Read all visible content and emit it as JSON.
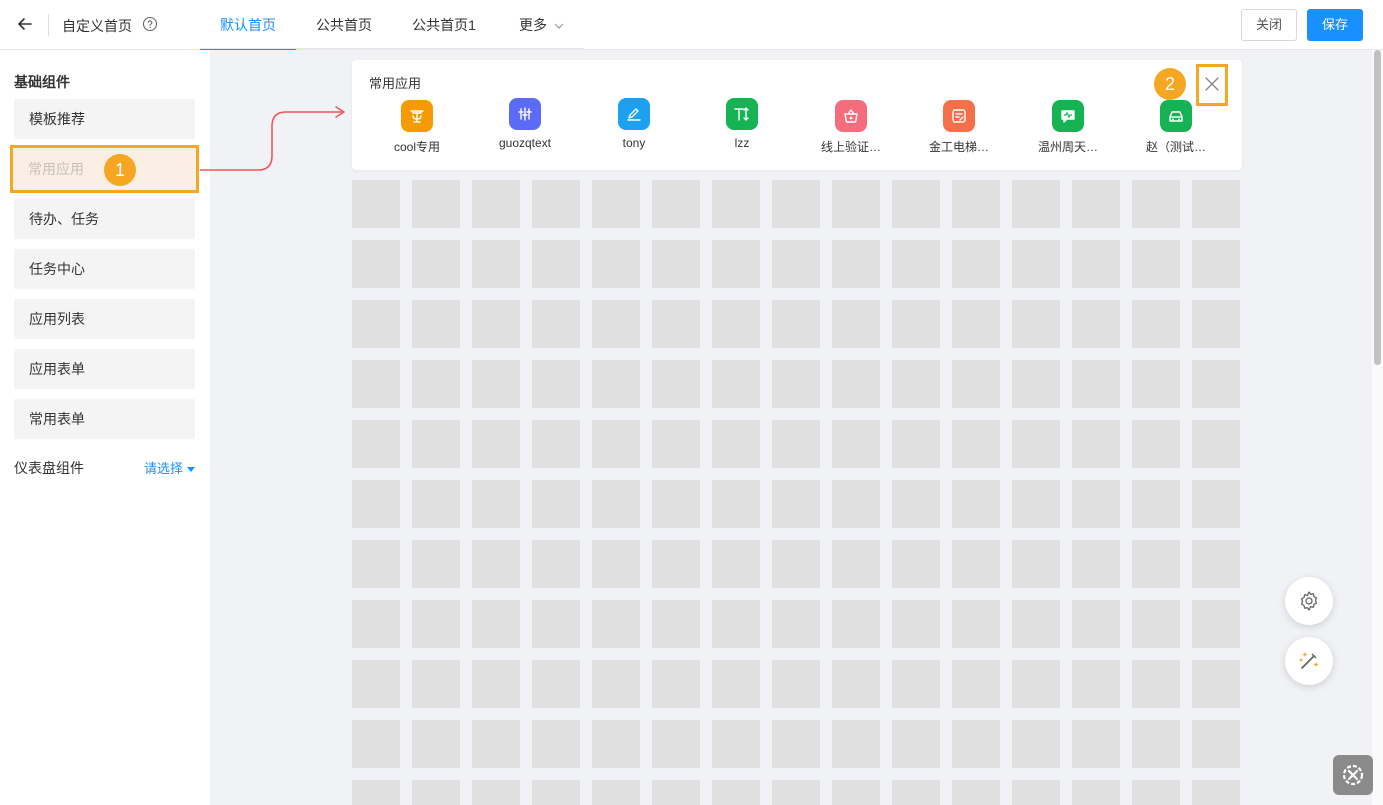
{
  "header": {
    "title": "自定义首页",
    "tabs": [
      {
        "label": "默认首页",
        "active": true
      },
      {
        "label": "公共首页",
        "active": false
      },
      {
        "label": "公共首页1",
        "active": false
      },
      {
        "label": "更多",
        "active": false
      }
    ],
    "close_label": "关闭",
    "save_label": "保存"
  },
  "sidebar": {
    "section_title": "基础组件",
    "items": [
      {
        "label": "模板推荐"
      },
      {
        "label": "常用应用",
        "selected": true
      },
      {
        "label": "待办、任务"
      },
      {
        "label": "任务中心"
      },
      {
        "label": "应用列表"
      },
      {
        "label": "应用表单"
      },
      {
        "label": "常用表单"
      }
    ],
    "dashboard_label": "仪表盘组件",
    "dashboard_select": "请选择"
  },
  "widget": {
    "title": "常用应用",
    "apps": [
      {
        "label": "cool专用",
        "color": "#f59a00",
        "icon": "fountain-icon"
      },
      {
        "label": "guozqtext",
        "color": "#5b6bf5",
        "icon": "chart-icon"
      },
      {
        "label": "tony",
        "color": "#1ea0f0",
        "icon": "pencil-icon"
      },
      {
        "label": "lzz",
        "color": "#16b355",
        "icon": "text-height-icon"
      },
      {
        "label": "线上验证…",
        "color": "#f56c7c",
        "icon": "basket-icon"
      },
      {
        "label": "金工电梯…",
        "color": "#f5704a",
        "icon": "document-icon"
      },
      {
        "label": "温州周天…",
        "color": "#16b355",
        "icon": "chat-icon"
      },
      {
        "label": "赵（测试…",
        "color": "#16b355",
        "icon": "car-icon"
      }
    ]
  },
  "annotations": {
    "badge_1": "1",
    "badge_2": "2"
  },
  "colors": {
    "accent": "#1890ff",
    "highlight": "#f5a623",
    "arrow": "#f0565a"
  }
}
